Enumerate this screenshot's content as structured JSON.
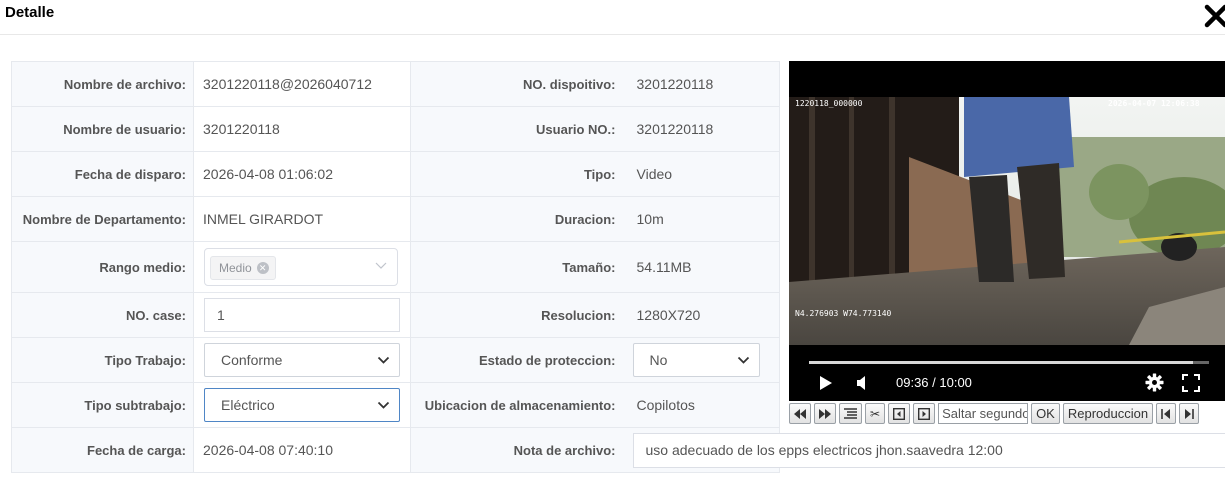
{
  "dialog": {
    "title": "Detalle"
  },
  "left": {
    "file_name": {
      "label": "Nombre de archivo:",
      "value": "3201220118@2026040712"
    },
    "user_name": {
      "label": "Nombre de usuario:",
      "value": "3201220118"
    },
    "trigger_date": {
      "label": "Fecha de disparo:",
      "value": "2026-04-08 01:06:02"
    },
    "department": {
      "label": "Nombre de Departamento:",
      "value": "INMEL GIRARDOT"
    },
    "media_range": {
      "label": "Rango medio:",
      "tag": "Medio"
    },
    "case_no": {
      "label": "NO. case:",
      "value": "1"
    },
    "work_type": {
      "label": "Tipo Trabajo:",
      "value": "Conforme"
    },
    "work_subtype": {
      "label": "Tipo subtrabajo:",
      "value": "Eléctrico"
    },
    "upload_date": {
      "label": "Fecha de carga:",
      "value": "2026-04-08 07:40:10"
    }
  },
  "right": {
    "device_no": {
      "label": "NO. dispoitivo:",
      "value": "3201220118"
    },
    "user_no": {
      "label": "Usuario NO.:",
      "value": "3201220118"
    },
    "type": {
      "label": "Tipo:",
      "value": "Video"
    },
    "duration": {
      "label": "Duracion:",
      "value": "10m"
    },
    "size": {
      "label": "Tamaño:",
      "value": "54.11MB"
    },
    "resolution": {
      "label": "Resolucion:",
      "value": "1280X720"
    },
    "protection": {
      "label": "Estado de proteccion:",
      "value": "No"
    },
    "storage": {
      "label": "Ubicacion de almacenamiento:",
      "value": "Copilotos"
    },
    "file_note": {
      "label": "Nota de archivo:",
      "value": "uso adecuado de los epps electricos jhon.saavedra 12:00"
    }
  },
  "player": {
    "osd_id": "1220118_000000",
    "osd_datetime": "2026-04-07 12:06:38",
    "osd_gps": "N4.276903  W74.773140",
    "time": "09:36 / 10:00",
    "progress": 0.96
  },
  "toolbar": {
    "jump_placeholder": "Saltar segundo",
    "ok_label": "OK",
    "play_label": "Reproduccion"
  }
}
